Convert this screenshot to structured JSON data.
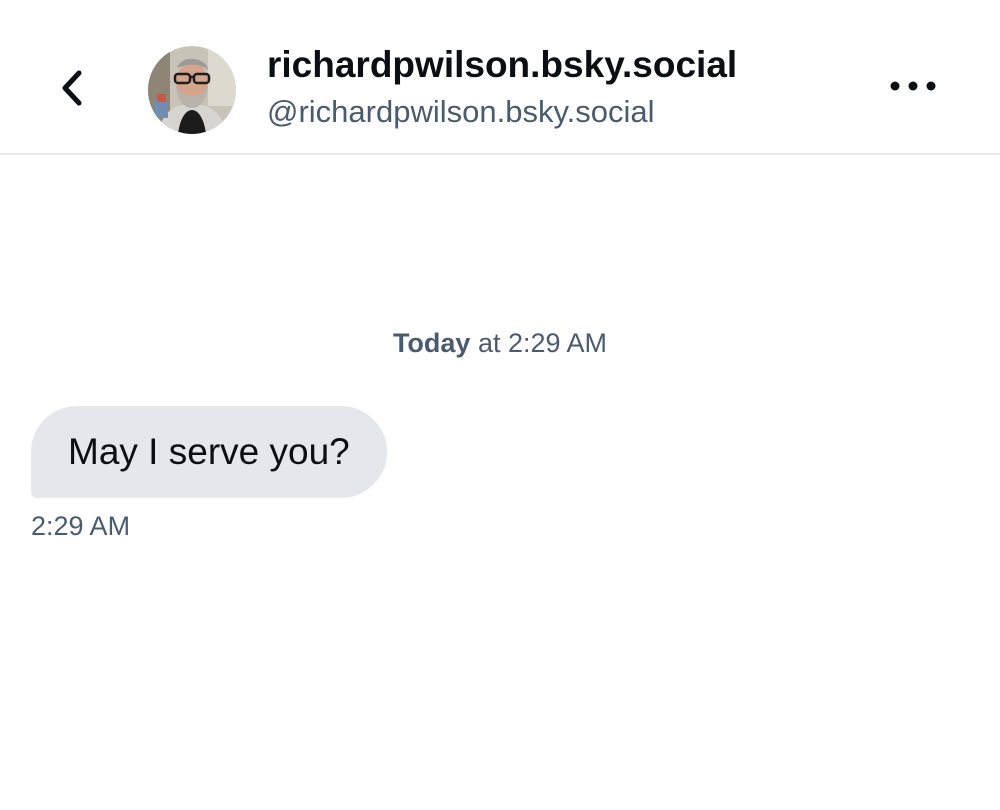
{
  "header": {
    "back_icon": "chevron-left-icon",
    "display_name": "richardpwilson.bsky.social",
    "handle": "@richardpwilson.bsky.social",
    "more_icon": "ellipsis-horizontal-icon"
  },
  "conversation": {
    "date_divider": {
      "day": "Today",
      "rest": " at 2:29 AM"
    },
    "messages": [
      {
        "text": "May I serve you?",
        "time": "2:29 AM"
      }
    ]
  },
  "colors": {
    "text_primary": "#0b0f14",
    "text_secondary": "#4b5b6f",
    "bubble_background": "#e4e8ed",
    "divider": "#e8ebef"
  }
}
